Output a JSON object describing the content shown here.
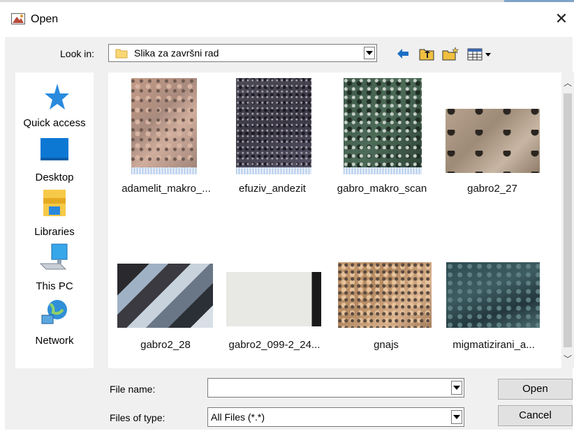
{
  "window": {
    "title": "Open"
  },
  "lookin": {
    "label": "Look in:",
    "value": "Slika za završni rad"
  },
  "places": [
    {
      "label": "Quick access",
      "icon": "star-icon"
    },
    {
      "label": "Desktop",
      "icon": "desktop-icon"
    },
    {
      "label": "Libraries",
      "icon": "libraries-icon"
    },
    {
      "label": "This PC",
      "icon": "computer-icon"
    },
    {
      "label": "Network",
      "icon": "network-icon"
    }
  ],
  "files": [
    {
      "name": "adamelit_makro_...",
      "texture": "granite-pink"
    },
    {
      "name": "efuziv_andezit",
      "texture": "andesite-dark"
    },
    {
      "name": "gabro_makro_scan",
      "texture": "gabbro-green"
    },
    {
      "name": "gabro2_27",
      "texture": "thin-section-tan"
    },
    {
      "name": "gabro2_28",
      "texture": "thin-section-blue"
    },
    {
      "name": "gabro2_099-2_24...",
      "texture": "pale-slab"
    },
    {
      "name": "gnajs",
      "texture": "gneiss-orange"
    },
    {
      "name": "migmatizirani_a...",
      "texture": "migmatite-teal"
    }
  ],
  "filename": {
    "label": "File name:",
    "value": ""
  },
  "filetype": {
    "label": "Files of type:",
    "value": "All Files (*.*)"
  },
  "buttons": {
    "open": "Open",
    "cancel": "Cancel"
  }
}
